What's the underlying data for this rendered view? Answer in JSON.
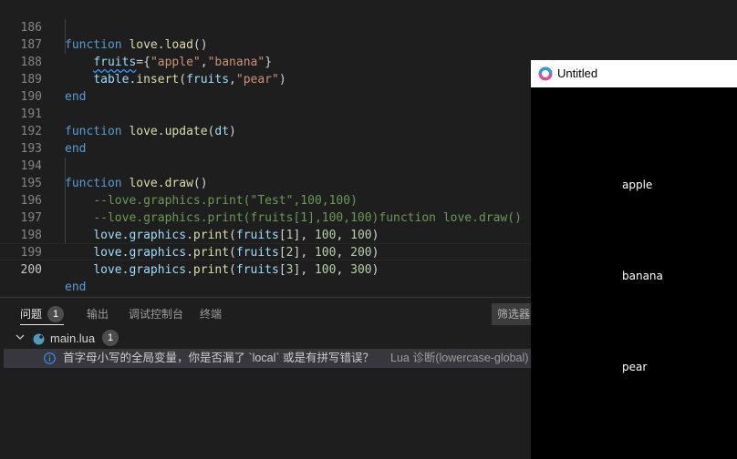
{
  "editor": {
    "line_numbers": [
      "186",
      "187",
      "188",
      "189",
      "190",
      "191",
      "192",
      "193",
      "194",
      "195",
      "196",
      "197",
      "198",
      "199",
      "200"
    ],
    "current_line": "200",
    "code": {
      "kw_function": "function",
      "kw_end": "end",
      "l186_name": "love.load",
      "l186_paren": "()",
      "l187_var": "fruits",
      "l187_eq": "={",
      "l187_s1": "\"apple\"",
      "l187_comma": ",",
      "l187_s2": "\"banana\"",
      "l187_close": "}",
      "l188_obj": "table",
      "l188_dot": ".",
      "l188_fn": "insert",
      "l188_open": "(",
      "l188_arg": "fruits",
      "l188_comma": ",",
      "l188_s": "\"pear\"",
      "l188_close": ")",
      "l191_name": "love.update",
      "l191_open": "(",
      "l191_param": "dt",
      "l191_close": ")",
      "l194_name": "love.draw",
      "l194_paren": "()",
      "l195_comment": "--love.graphics.print(\"Test\",100,100)",
      "l196_comment": "--love.graphics.print(fruits[1],100,100)function love.draw()",
      "print_love": "love",
      "print_graphics": "graphics",
      "print_fn": "print",
      "arr": "fruits",
      "l197_idx": "1",
      "l197_y": "100",
      "l198_idx": "2",
      "l198_y": "200",
      "l199_idx": "3",
      "l199_y": "300",
      "x_val": "100"
    }
  },
  "panel": {
    "tabs": [
      {
        "label": "问题",
        "badge": "1"
      },
      {
        "label": "输出"
      },
      {
        "label": "调试控制台"
      },
      {
        "label": "终端"
      }
    ],
    "filter_placeholder": "筛选器",
    "file": {
      "name": "main.lua",
      "count": "1"
    },
    "problem": {
      "message": "首字母小写的全局变量，你是否漏了 `local` 或是有拼写错误？",
      "source": "Lua 诊断(lowercase-global)"
    }
  },
  "love_window": {
    "title": "Untitled",
    "texts": [
      "apple",
      "banana",
      "pear"
    ]
  },
  "colors": {
    "editor_bg": "#1e1e1e",
    "keyword": "#569cd6",
    "function": "#dcdcaa",
    "string": "#ce9178",
    "comment": "#6a9955",
    "number": "#b5cea8",
    "info": "#3794ff"
  }
}
